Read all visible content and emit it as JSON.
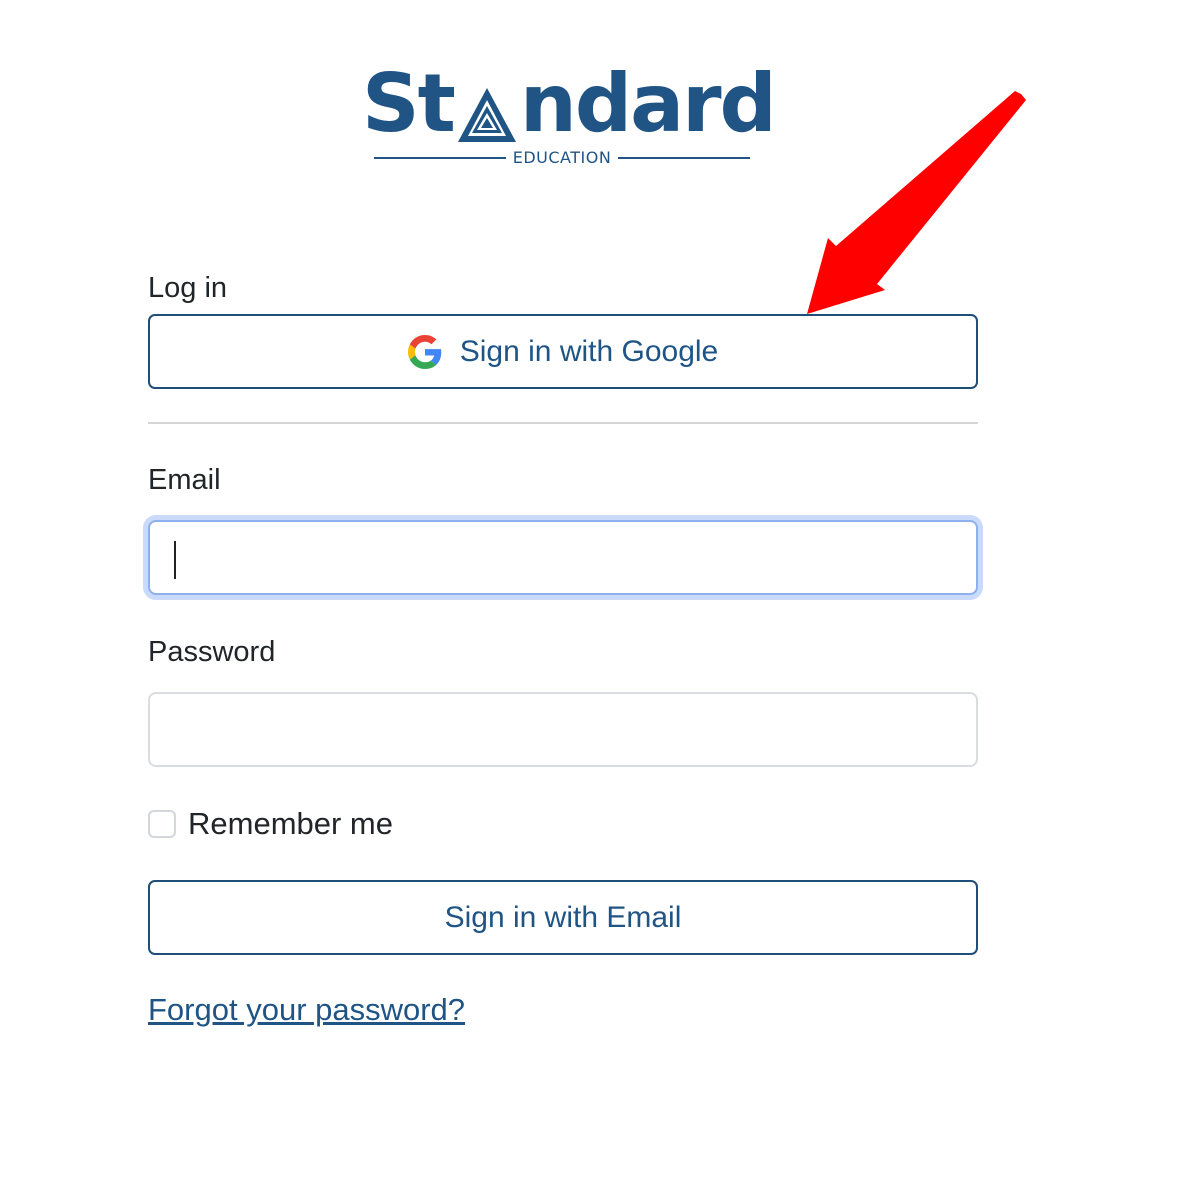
{
  "logo": {
    "prefix": "St",
    "suffix": "ndard",
    "subtitle": "EDUCATION",
    "brand_color": "#1f5485"
  },
  "login": {
    "heading": "Log in",
    "google_button_label": "Sign in with Google",
    "google_icon": "google-g-icon"
  },
  "email": {
    "label": "Email",
    "value": "",
    "focused": true
  },
  "password": {
    "label": "Password",
    "value": ""
  },
  "remember": {
    "label": "Remember me",
    "checked": false
  },
  "email_button_label": "Sign in with Email",
  "forgot_link": "Forgot your password?",
  "annotation": {
    "type": "arrow",
    "color": "#ff0000",
    "points_to": "google-sign-in-button"
  },
  "colors": {
    "accent": "#1f5485",
    "focus_ring": "#c9dafa",
    "annotation": "#ff0000"
  }
}
